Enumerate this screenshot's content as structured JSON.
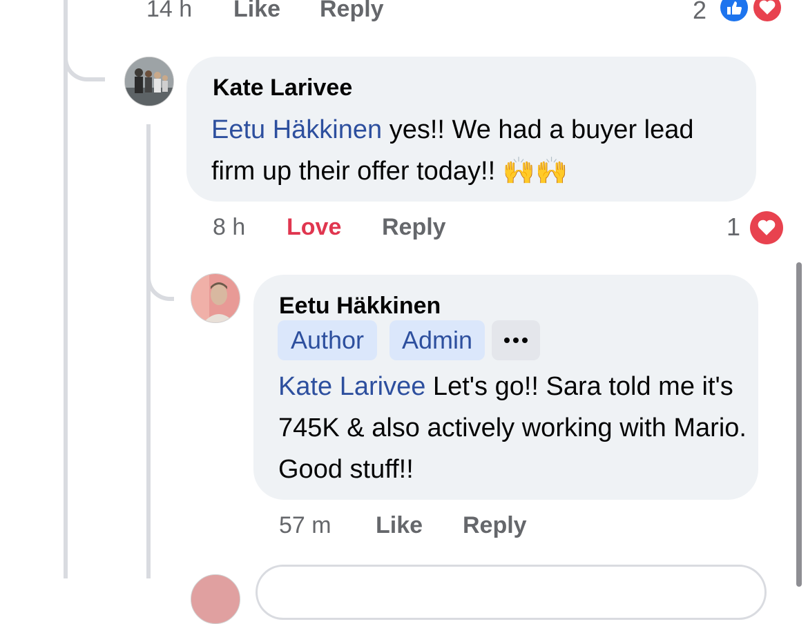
{
  "top_row": {
    "time": "14 h",
    "like_label": "Like",
    "reply_label": "Reply",
    "reaction_count": "2",
    "reaction_icons": [
      "like-icon",
      "heart-icon"
    ]
  },
  "comment1": {
    "author": "Kate Larivee",
    "mention": "Eetu Häkkinen",
    "text": " yes!! We had a buyer lead firm up their offer today!! 🙌🙌",
    "time": "8 h",
    "reaction_label": "Love",
    "reply_label": "Reply",
    "reaction_count": "1",
    "reaction_icons": [
      "heart-icon"
    ]
  },
  "comment2": {
    "author": "Eetu Häkkinen",
    "badges": [
      "Author",
      "Admin"
    ],
    "more_icon": "more-icon",
    "mention": "Kate Larivee",
    "text": " Let's go!! Sara told me it's 745K & also actively working with Mario. Good stuff!!",
    "time": "57 m",
    "like_label": "Like",
    "reply_label": "Reply"
  },
  "colors": {
    "mention": "#2d4f9e",
    "love": "#e0364f",
    "bubble": "#eff2f5",
    "badge_bg": "#dbe7fb"
  }
}
